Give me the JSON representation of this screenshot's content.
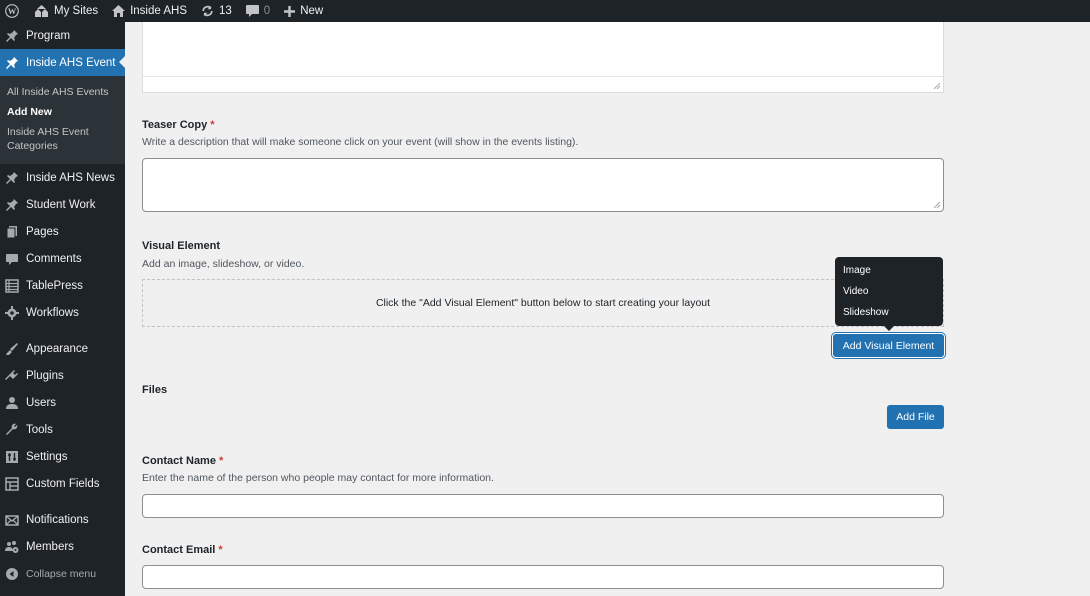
{
  "adminbar": {
    "my_sites": "My Sites",
    "site_name": "Inside AHS",
    "updates_count": "13",
    "comments_count": "0",
    "new_label": "New"
  },
  "sidebar": {
    "items": [
      {
        "label": "Program",
        "icon": "pin-icon"
      },
      {
        "label": "Inside AHS Event",
        "icon": "pin-icon",
        "active": true
      },
      {
        "label": "Inside AHS News",
        "icon": "pin-icon"
      },
      {
        "label": "Student Work",
        "icon": "pin-icon"
      },
      {
        "label": "Pages",
        "icon": "pages-icon"
      },
      {
        "label": "Comments",
        "icon": "comment-icon"
      },
      {
        "label": "TablePress",
        "icon": "table-icon"
      },
      {
        "label": "Workflows",
        "icon": "gear-icon"
      },
      {
        "label": "Appearance",
        "icon": "brush-icon"
      },
      {
        "label": "Plugins",
        "icon": "plug-icon"
      },
      {
        "label": "Users",
        "icon": "user-icon"
      },
      {
        "label": "Tools",
        "icon": "wrench-icon"
      },
      {
        "label": "Settings",
        "icon": "settings-icon"
      },
      {
        "label": "Custom Fields",
        "icon": "fields-icon"
      },
      {
        "label": "Notifications",
        "icon": "envelope-icon"
      },
      {
        "label": "Members",
        "icon": "members-icon"
      },
      {
        "label": "Collapse menu",
        "icon": "collapse-icon"
      }
    ],
    "submenu": [
      {
        "label": "All Inside AHS Events"
      },
      {
        "label": "Add New",
        "current": true
      },
      {
        "label": "Inside AHS Event Categories"
      }
    ]
  },
  "form": {
    "teaser": {
      "label": "Teaser Copy",
      "required": "*",
      "description": "Write a description that will make someone click on your event (will show in the events listing).",
      "value": ""
    },
    "visual": {
      "label": "Visual Element",
      "description": "Add an image, slideshow, or video.",
      "empty_text": "Click the \"Add Visual Element\" button below to start creating your layout",
      "button": "Add Visual Element",
      "menu": [
        "Image",
        "Video",
        "Slideshow"
      ]
    },
    "files": {
      "label": "Files",
      "button": "Add File"
    },
    "contact_name": {
      "label": "Contact Name",
      "required": "*",
      "description": "Enter the name of the person who people may contact for more information.",
      "value": ""
    },
    "contact_email": {
      "label": "Contact Email",
      "required": "*",
      "value": ""
    }
  }
}
